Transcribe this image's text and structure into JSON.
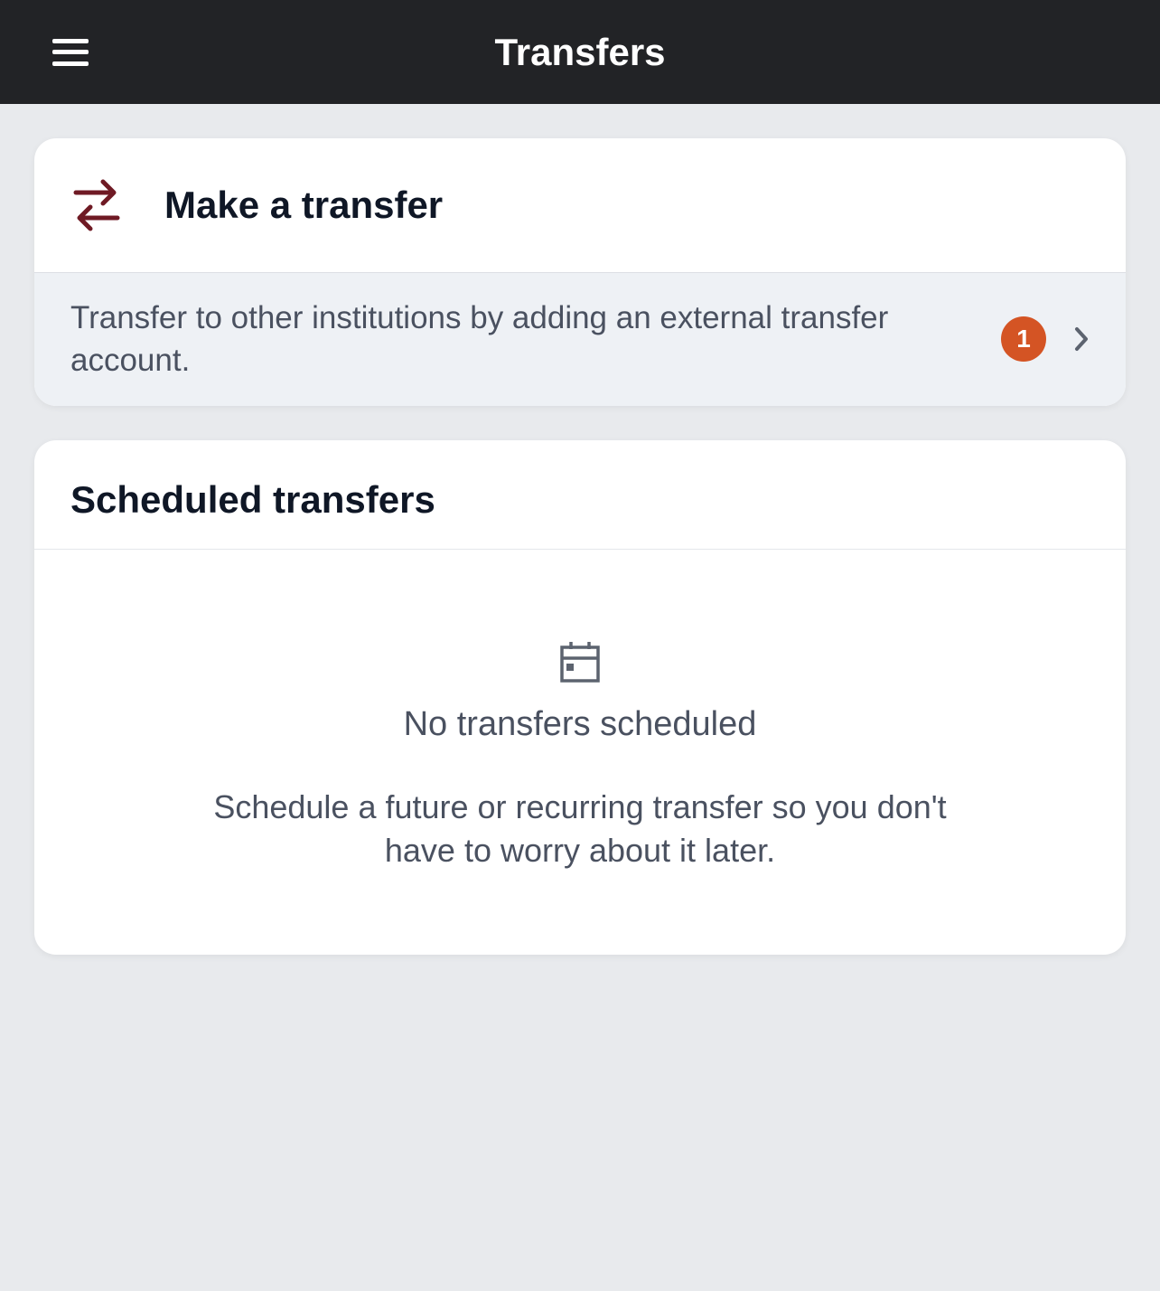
{
  "header": {
    "title": "Transfers"
  },
  "make_transfer": {
    "title": "Make a transfer",
    "external_prompt": "Transfer to other institutions by adding an external transfer account.",
    "badge_count": "1"
  },
  "scheduled": {
    "title": "Scheduled transfers",
    "empty_title": "No transfers scheduled",
    "empty_desc": "Schedule a future or recurring transfer so you don't have to worry about it later."
  }
}
